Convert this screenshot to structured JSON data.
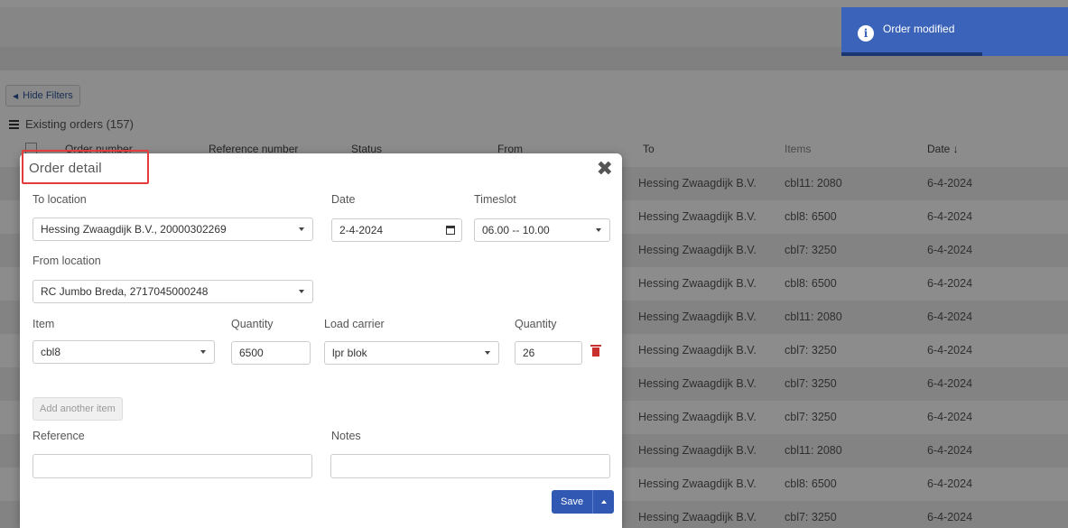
{
  "toast": {
    "message": "Order modified"
  },
  "filters": {
    "hide_label": "Hide Filters"
  },
  "orders": {
    "title": "Existing orders (157)",
    "columns": [
      "Order number",
      "Reference number",
      "Status",
      "From",
      "To",
      "Items",
      "Date ↓"
    ],
    "rows": [
      {
        "to": "Hessing Zwaagdijk B.V.",
        "items": "cbl11: 2080",
        "date": "6-4-2024"
      },
      {
        "to": "Hessing Zwaagdijk B.V.",
        "items": "cbl8: 6500",
        "date": "6-4-2024"
      },
      {
        "to": "Hessing Zwaagdijk B.V.",
        "items": "cbl7: 3250",
        "date": "6-4-2024"
      },
      {
        "to": "Hessing Zwaagdijk B.V.",
        "items": "cbl8: 6500",
        "date": "6-4-2024"
      },
      {
        "to": "Hessing Zwaagdijk B.V.",
        "items": "cbl11: 2080",
        "date": "6-4-2024"
      },
      {
        "to": "Hessing Zwaagdijk B.V.",
        "items": "cbl7: 3250",
        "date": "6-4-2024"
      },
      {
        "to": "Hessing Zwaagdijk B.V.",
        "items": "cbl7: 3250",
        "date": "6-4-2024"
      },
      {
        "to": "Hessing Zwaagdijk B.V.",
        "items": "cbl7: 3250",
        "date": "6-4-2024"
      },
      {
        "to": "Hessing Zwaagdijk B.V.",
        "items": "cbl11: 2080",
        "date": "6-4-2024"
      },
      {
        "to": "Hessing Zwaagdijk B.V.",
        "items": "cbl8: 6500",
        "date": "6-4-2024"
      },
      {
        "to": "Hessing Zwaagdijk B.V.",
        "items": "cbl7: 3250",
        "date": "6-4-2024"
      }
    ]
  },
  "modal": {
    "title": "Order detail",
    "to_location": {
      "label": "To location",
      "value": "Hessing Zwaagdijk B.V., 20000302269"
    },
    "date": {
      "label": "Date",
      "value": "2-4-2024"
    },
    "timeslot": {
      "label": "Timeslot",
      "value": "06.00 -- 10.00"
    },
    "from_location": {
      "label": "From location",
      "value": "RC Jumbo Breda, 2717045000248"
    },
    "item": {
      "label": "Item",
      "value": "cbl8"
    },
    "item_quantity": {
      "label": "Quantity",
      "value": "6500"
    },
    "load_carrier": {
      "label": "Load carrier",
      "value": "lpr blok"
    },
    "carrier_quantity": {
      "label": "Quantity",
      "value": "26"
    },
    "add_item_label": "Add another item",
    "reference": {
      "label": "Reference",
      "value": ""
    },
    "notes": {
      "label": "Notes",
      "value": ""
    },
    "save_label": "Save"
  }
}
